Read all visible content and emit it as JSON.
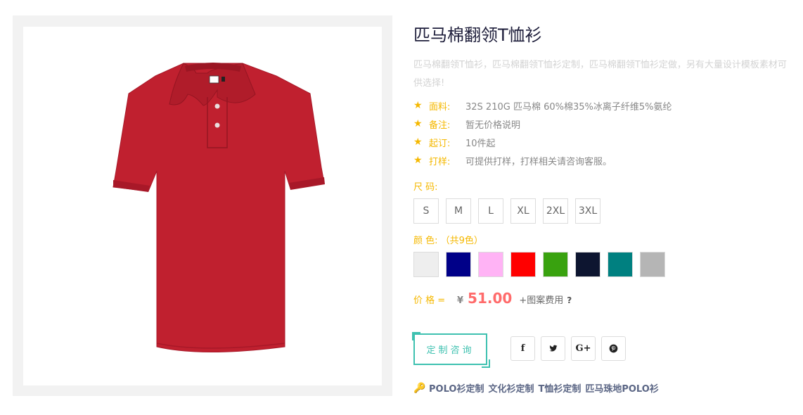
{
  "product": {
    "title": "匹马棉翻领T恤衫",
    "description": "匹马棉翻领T恤衫，匹马棉翻领T恤衫定制，匹马棉翻领T恤衫定做，另有大量设计模板素材可供选择!"
  },
  "attributes": [
    {
      "icon": "star-icon",
      "key": "面料:",
      "value": "32S 210G 匹马棉 60%棉35%冰离子纤维5%氨纶"
    },
    {
      "icon": "star-icon",
      "key": "备注:",
      "value": "暂无价格说明"
    },
    {
      "icon": "star-icon",
      "key": "起订:",
      "value": "10件起"
    },
    {
      "icon": "star-icon",
      "key": "打样:",
      "value": "可提供打样，打样相关请咨询客服。"
    }
  ],
  "size_label": "尺 码:",
  "sizes": [
    "S",
    "M",
    "L",
    "XL",
    "2XL",
    "3XL"
  ],
  "color_label": "颜 色: （共9色）",
  "colors": [
    "#eeeeee",
    "#000088",
    "#ffb3f5",
    "#ff0000",
    "#39a20f",
    "#0d1530",
    "#008080",
    "#b5b5b5"
  ],
  "price": {
    "label": "价 格 =",
    "currency": "¥",
    "value": "51.00",
    "extra": "+图案费用",
    "help": "?"
  },
  "consult_button": "定制咨询",
  "socials": [
    {
      "name": "facebook-icon",
      "glyph": "f"
    },
    {
      "name": "twitter-icon",
      "glyph": "🐦"
    },
    {
      "name": "google-plus-icon",
      "glyph": "G+"
    },
    {
      "name": "pinterest-icon",
      "glyph": "ⓟ"
    }
  ],
  "tags": [
    "POLO衫定制",
    "文化衫定制",
    "T恤衫定制",
    "匹马珠地POLO衫"
  ],
  "shirt_color": "#c0202f"
}
